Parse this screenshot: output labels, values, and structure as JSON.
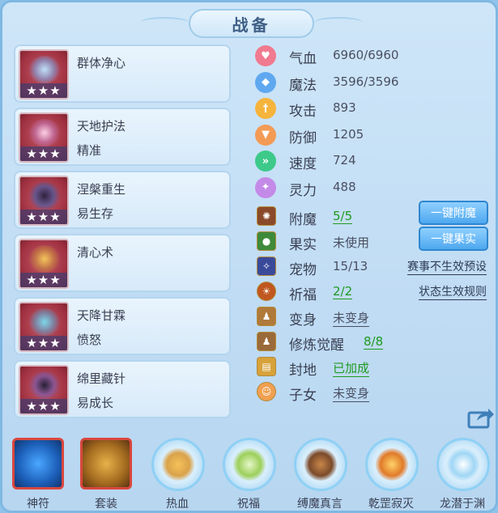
{
  "title": "战备",
  "skills": [
    {
      "name": "群体净心",
      "sub": "",
      "stars": "★★★",
      "icon": "dragon-skill-icon",
      "color": "#a84a5d"
    },
    {
      "name": "天地护法",
      "sub": "精准",
      "stars": "★★★",
      "icon": "sword-skill-icon",
      "color": "#9c2f40"
    },
    {
      "name": "涅槃重生",
      "sub": "易生存",
      "stars": "★★★",
      "icon": "phoenix-skill-icon",
      "color": "#a63343"
    },
    {
      "name": "清心术",
      "sub": "",
      "stars": "★★★",
      "icon": "serpent-skill-icon",
      "color": "#a43a4b"
    },
    {
      "name": "天降甘霖",
      "sub": "愤怒",
      "stars": "★★★",
      "icon": "ring-skill-icon",
      "color": "#9a2f3d"
    },
    {
      "name": "绵里藏针",
      "sub": "易成长",
      "stars": "★★★",
      "icon": "spirit-skill-icon",
      "color": "#a13444"
    }
  ],
  "stats": [
    {
      "label": "气血",
      "value": "6960/6960",
      "icon": "heart-icon",
      "color": "#f07a8f"
    },
    {
      "label": "魔法",
      "value": "3596/3596",
      "icon": "mana-icon",
      "color": "#5fa8f0"
    },
    {
      "label": "攻击",
      "value": "893",
      "icon": "attack-icon",
      "color": "#f5b43c"
    },
    {
      "label": "防御",
      "value": "1205",
      "icon": "defense-icon",
      "color": "#f39b55"
    },
    {
      "label": "速度",
      "value": "724",
      "icon": "speed-icon",
      "color": "#3cc98a"
    },
    {
      "label": "灵力",
      "value": "488",
      "icon": "spirit-icon",
      "color": "#c48ae8"
    }
  ],
  "details": {
    "enchant": {
      "label": "附魔",
      "value": "5/5",
      "icon": "enchant-icon"
    },
    "fruit": {
      "label": "果实",
      "value": "未使用",
      "icon": "fruit-icon"
    },
    "pet": {
      "label": "宠物",
      "value": "15/13",
      "icon": "pet-icon"
    },
    "bless": {
      "label": "祈福",
      "value": "2/2",
      "icon": "bless-icon"
    },
    "transform": {
      "label": "变身",
      "value": "未变身",
      "icon": "transform-icon"
    },
    "awaken": {
      "label": "修炼觉醒",
      "value": "8/8",
      "icon": "awaken-icon"
    },
    "fief": {
      "label": "封地",
      "value": "已加成",
      "icon": "fief-icon"
    },
    "children": {
      "label": "子女",
      "value": "未变身",
      "icon": "children-icon"
    }
  },
  "buttons": {
    "enchant_all": "一键附魔",
    "fruit_all": "一键果实"
  },
  "links": {
    "event_preset": "赛事不生效预设",
    "status_rules": "状态生效规则"
  },
  "bottom": [
    {
      "label": "神符",
      "icon": "talisman-icon",
      "style": "square",
      "underline": true
    },
    {
      "label": "套装",
      "icon": "suit-icon",
      "style": "square",
      "underline": true
    },
    {
      "label": "热血",
      "icon": "passion-icon",
      "style": "ring",
      "underline": false
    },
    {
      "label": "祝福",
      "icon": "blessing-icon",
      "style": "ring",
      "underline": false
    },
    {
      "label": "缚魔真言",
      "icon": "bind-demon-icon",
      "style": "ring",
      "underline": false
    },
    {
      "label": "乾罡寂灭",
      "icon": "qiangang-icon",
      "style": "ring",
      "underline": false
    },
    {
      "label": "龙潜于渊",
      "icon": "dragon-abyss-icon",
      "style": "ring",
      "underline": false
    }
  ]
}
